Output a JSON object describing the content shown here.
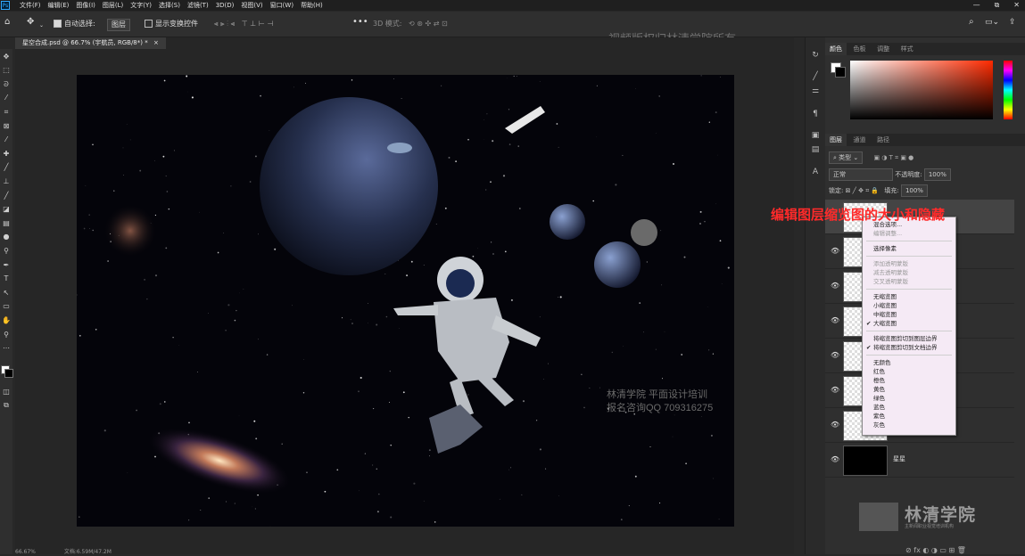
{
  "menubar": {
    "logo": "Ps",
    "items": [
      "文件(F)",
      "编辑(E)",
      "图像(I)",
      "图层(L)",
      "文字(Y)",
      "选择(S)",
      "滤镜(T)",
      "3D(D)",
      "视图(V)",
      "窗口(W)",
      "帮助(H)"
    ],
    "controls": [
      "—",
      "⧉",
      "✕"
    ]
  },
  "options": {
    "auto_select_label": "自动选择:",
    "auto_select_value": "图层",
    "show_transform_label": "显示变换控件",
    "mode_3d": "3D 模式:",
    "watermark": "视频版权归林清学院所有"
  },
  "document": {
    "tab_title": "星空合成.psd @ 66.7% (宇航员, RGB/8*) *",
    "tab_close": "×"
  },
  "canvas": {
    "watermark_line1": "林清学院  平面设计培训",
    "watermark_line2": "报名咨询QQ 709316275"
  },
  "color_panel": {
    "tabs": [
      "颜色",
      "色板",
      "调整",
      "样式"
    ]
  },
  "layers_panel": {
    "tabs": [
      "图层",
      "通道",
      "路径"
    ],
    "filter_kind": "类型",
    "blend_mode": "正常",
    "opacity_label": "不透明度:",
    "opacity_value": "100%",
    "lock_label": "锁定:",
    "fill_label": "填充:",
    "fill_value": "100%",
    "layers": [
      {
        "name": "星星",
        "dark": true
      }
    ]
  },
  "context_menu": {
    "items_top": [
      {
        "label": "混合选项...",
        "disabled": false
      },
      {
        "label": "编辑调整...",
        "disabled": true
      }
    ],
    "select_pixels": "选择像素",
    "transparency": [
      "添加透明蒙版",
      "减去透明蒙版",
      "交叉透明蒙版"
    ],
    "sizes": [
      {
        "label": "无缩览图",
        "checked": false
      },
      {
        "label": "小缩览图",
        "checked": false
      },
      {
        "label": "中缩览图",
        "checked": false
      },
      {
        "label": "大缩览图",
        "checked": true
      }
    ],
    "clip": [
      {
        "label": "将缩览图剪切到图层边界",
        "checked": false
      },
      {
        "label": "将缩览图剪切到文档边界",
        "checked": true
      }
    ],
    "colors": [
      "无颜色",
      "红色",
      "橙色",
      "黄色",
      "绿色",
      "蓝色",
      "紫色",
      "灰色"
    ]
  },
  "annotation": "编辑图层缩览图的大小和隐藏",
  "branding": {
    "name": "林清学院",
    "sub": "主新闻职业视觉培训机构",
    "stamp": "林清学院"
  },
  "status": {
    "zoom": "66.67%",
    "doc": "文档:6.59M/47.2M"
  },
  "icons": {
    "move": "move-icon",
    "home": "home-icon",
    "search": "search-icon",
    "eye": "eye-icon"
  }
}
